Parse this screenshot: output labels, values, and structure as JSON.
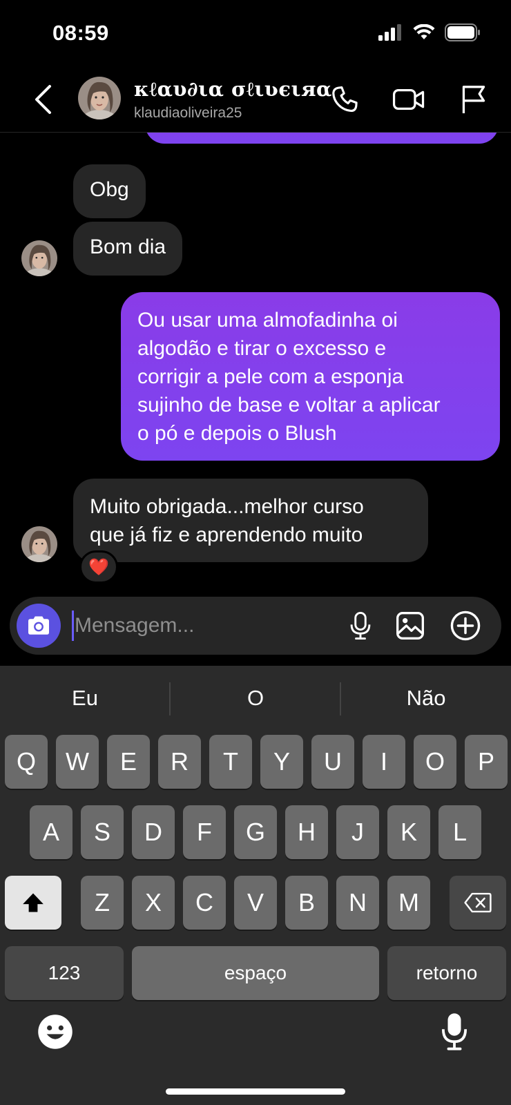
{
  "status_bar": {
    "time": "08:59"
  },
  "header": {
    "name": "κℓαυ∂ια σℓιʋєιяα",
    "username": "klaudiaoliveira25"
  },
  "messages": [
    {
      "from": "them",
      "text": "Obg"
    },
    {
      "from": "them",
      "text": "Bom dia"
    },
    {
      "from": "me",
      "lines": [
        "Ou usar uma almofadinha oi",
        "algodão e tirar o excesso e",
        "corrigir a pele com a esponja",
        "sujinho de base e voltar a aplicar",
        "o pó e depois o Blush"
      ]
    },
    {
      "from": "them",
      "lines": [
        "Muito obrigada...melhor curso",
        "que já fiz e aprendendo muito"
      ],
      "reaction": "❤️"
    }
  ],
  "composer": {
    "placeholder": "Mensagem..."
  },
  "keyboard": {
    "suggestions": [
      "Eu",
      "O",
      "Não"
    ],
    "row1": [
      "Q",
      "W",
      "E",
      "R",
      "T",
      "Y",
      "U",
      "I",
      "O",
      "P"
    ],
    "row2": [
      "A",
      "S",
      "D",
      "F",
      "G",
      "H",
      "J",
      "K",
      "L"
    ],
    "row3": [
      "Z",
      "X",
      "C",
      "V",
      "B",
      "N",
      "M"
    ],
    "numbers_label": "123",
    "space_label": "espaço",
    "return_label": "retorno"
  },
  "colors": {
    "outgoing_bubble": "#8a3ce8",
    "incoming_bubble": "#262626",
    "camera_button": "#5b51e0"
  }
}
